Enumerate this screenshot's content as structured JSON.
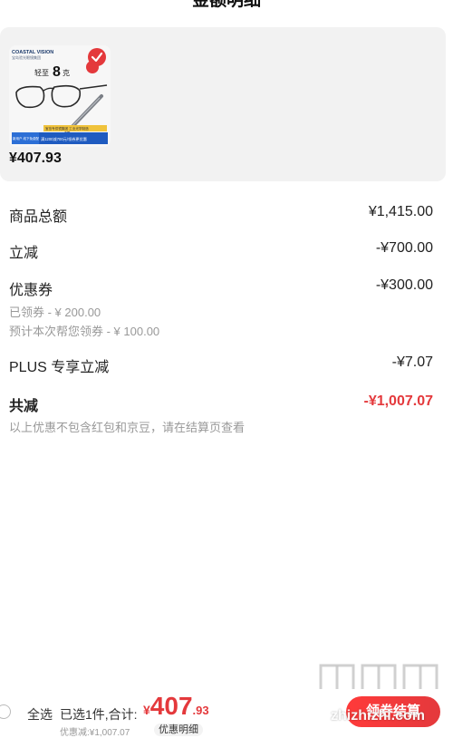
{
  "header": {
    "title": "金额明细"
  },
  "product": {
    "price": "¥407.93",
    "image": {
      "brand": "COASTAL VISION",
      "brand_sub": "宝岛验光眼镜集团",
      "weight_text_prefix": "轻至",
      "weight_number": "8",
      "weight_unit": "克",
      "promo_left": "新用户\n线下免费配镜",
      "promo_right": "满1200减700元/领券更优惠",
      "promo_top": "宝岛专供镜集团 工业光学制造"
    }
  },
  "breakdown": {
    "total": {
      "label": "商品总额",
      "value": "¥1,415.00"
    },
    "instant": {
      "label": "立减",
      "value": "-¥700.00"
    },
    "coupon": {
      "label": "优惠券",
      "value": "-¥300.00",
      "claimed": "已领券 - ¥ 200.00",
      "estimated": "预计本次帮您领券 - ¥ 100.00"
    },
    "plus": {
      "label": "PLUS 专享立减",
      "value": "-¥7.07"
    },
    "sum": {
      "label": "共减",
      "value": "-¥1,007.07"
    },
    "note": "以上优惠不包含红包和京豆，请在结算页查看"
  },
  "bottom_bar": {
    "select_all": "全选",
    "selected_total": "已选1件,合计:",
    "price_currency": "¥",
    "price_int": "407",
    "price_dec": ".93",
    "discount": "优惠减:¥1,007.07",
    "detail": "优惠明细",
    "checkout": "领券结算"
  },
  "watermark": {
    "text": "zhizhizhi.com",
    "logo": "值值值"
  },
  "colors": {
    "accent": "#e4393c",
    "panel": "#f2f2f2",
    "muted": "#999999"
  }
}
